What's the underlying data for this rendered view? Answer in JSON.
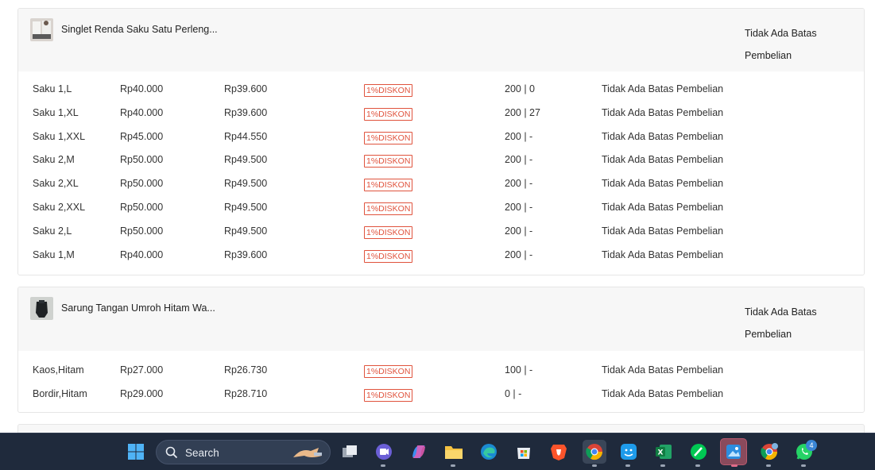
{
  "products": [
    {
      "name": "Singlet Renda Saku Satu  Perleng...",
      "purchase_limit": "Tidak Ada Batas Pembelian",
      "variants": [
        {
          "variant": "Saku 1,L",
          "price": "Rp40.000",
          "discounted_price": "Rp39.600",
          "discount": "1%DISKON",
          "stock": "200 | 0",
          "limit": "Tidak Ada Batas Pembelian"
        },
        {
          "variant": "Saku 1,XL",
          "price": "Rp40.000",
          "discounted_price": "Rp39.600",
          "discount": "1%DISKON",
          "stock": "200 | 27",
          "limit": "Tidak Ada Batas Pembelian"
        },
        {
          "variant": "Saku 1,XXL",
          "price": "Rp45.000",
          "discounted_price": "Rp44.550",
          "discount": "1%DISKON",
          "stock": "200 | -",
          "limit": "Tidak Ada Batas Pembelian"
        },
        {
          "variant": "Saku 2,M",
          "price": "Rp50.000",
          "discounted_price": "Rp49.500",
          "discount": "1%DISKON",
          "stock": "200 | -",
          "limit": "Tidak Ada Batas Pembelian"
        },
        {
          "variant": "Saku 2,XL",
          "price": "Rp50.000",
          "discounted_price": "Rp49.500",
          "discount": "1%DISKON",
          "stock": "200 | -",
          "limit": "Tidak Ada Batas Pembelian"
        },
        {
          "variant": "Saku 2,XXL",
          "price": "Rp50.000",
          "discounted_price": "Rp49.500",
          "discount": "1%DISKON",
          "stock": "200 | -",
          "limit": "Tidak Ada Batas Pembelian"
        },
        {
          "variant": "Saku 2,L",
          "price": "Rp50.000",
          "discounted_price": "Rp49.500",
          "discount": "1%DISKON",
          "stock": "200 | -",
          "limit": "Tidak Ada Batas Pembelian"
        },
        {
          "variant": "Saku 1,M",
          "price": "Rp40.000",
          "discounted_price": "Rp39.600",
          "discount": "1%DISKON",
          "stock": "200 | -",
          "limit": "Tidak Ada Batas Pembelian"
        }
      ]
    },
    {
      "name": "Sarung Tangan Umroh Hitam Wa...",
      "purchase_limit": "Tidak Ada Batas Pembelian",
      "variants": [
        {
          "variant": "Kaos,Hitam",
          "price": "Rp27.000",
          "discounted_price": "Rp26.730",
          "discount": "1%DISKON",
          "stock": "100 | -",
          "limit": "Tidak Ada Batas Pembelian"
        },
        {
          "variant": "Bordir,Hitam",
          "price": "Rp29.000",
          "discounted_price": "Rp28.710",
          "discount": "1%DISKON",
          "stock": "0 | -",
          "limit": "Tidak Ada Batas Pembelian"
        }
      ]
    }
  ],
  "taskbar": {
    "search_label": "Search",
    "apps": [
      {
        "name": "start-icon"
      },
      {
        "name": "task-view-icon"
      },
      {
        "name": "chat-icon"
      },
      {
        "name": "copilot-icon"
      },
      {
        "name": "file-explorer-icon"
      },
      {
        "name": "edge-icon"
      },
      {
        "name": "store-icon"
      },
      {
        "name": "brave-icon"
      },
      {
        "name": "chrome-icon"
      },
      {
        "name": "finder-icon"
      },
      {
        "name": "excel-icon"
      },
      {
        "name": "notes-icon"
      },
      {
        "name": "photos-icon"
      },
      {
        "name": "chrome-profile-icon"
      },
      {
        "name": "whatsapp-icon",
        "badge": "4"
      }
    ]
  },
  "colors": {
    "discount_badge": "#e0533d",
    "card_header_bg": "#f7f7f7",
    "taskbar_bg": "#1f2a3c"
  }
}
